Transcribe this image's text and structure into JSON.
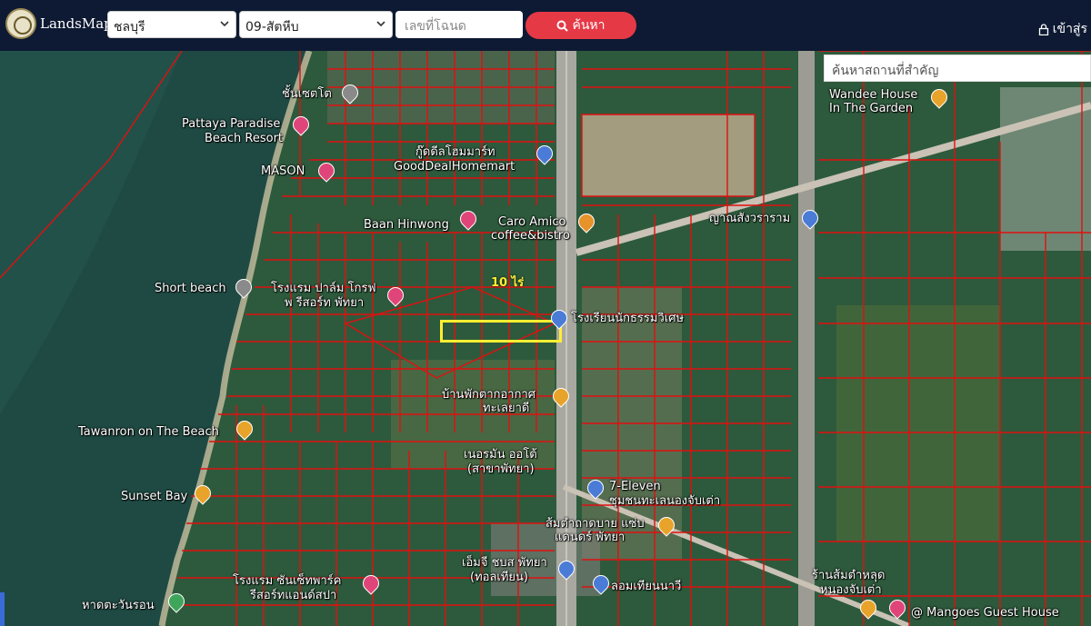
{
  "header": {
    "brand": "LandsMaps",
    "province": "ชลบุรี",
    "district": "09-สัตหีบ",
    "deed_placeholder": "เลขที่โฉนด",
    "search_label": "ค้นหา",
    "login_label": "เข้าสู่ร"
  },
  "map": {
    "place_search_placeholder": "ค้นหาสถานที่สำคัญ",
    "highlight_label": "10 ไร่",
    "places": [
      {
        "name": "ชั้นเซตโต",
        "icon": "photo-pin-icon"
      },
      {
        "name": "Pattaya Paradise",
        "icon": "hotel-pin-icon"
      },
      {
        "name": "Beach Resort",
        "icon": ""
      },
      {
        "name": "MASON",
        "icon": "hotel-pin-icon"
      },
      {
        "name": "กู๊ดดีลโฮมมาร์ท",
        "icon": "shop-pin-icon"
      },
      {
        "name": "GoodDealHomemart",
        "icon": ""
      },
      {
        "name": "Baan Hinwong",
        "icon": "hotel-pin-icon"
      },
      {
        "name": "Caro Amico",
        "icon": "cafe-pin-icon"
      },
      {
        "name": "coffee&bistro",
        "icon": ""
      },
      {
        "name": "ญาณสังวราราม",
        "icon": "temple-pin-icon"
      },
      {
        "name": "Wandee House",
        "icon": "restaurant-pin-icon"
      },
      {
        "name": "In The Garden",
        "icon": ""
      },
      {
        "name": "Short beach",
        "icon": "photo-pin-icon"
      },
      {
        "name": "โรงแรม ปาล์ม โกรฟ",
        "icon": "hotel-pin-icon"
      },
      {
        "name": "พ รีสอร์ท พัทยา",
        "icon": ""
      },
      {
        "name": "โรงเรียนนักธรรมวิเศษ",
        "icon": "school-pin-icon"
      },
      {
        "name": "บ้านพักตากอากาศ",
        "icon": "restaurant-pin-icon"
      },
      {
        "name": "ทะเลยาดี",
        "icon": ""
      },
      {
        "name": "Tawanron on The Beach",
        "icon": "restaurant-pin-icon"
      },
      {
        "name": "เนอรมัน ออโต้",
        "icon": ""
      },
      {
        "name": "(สาขาพัทยา)",
        "icon": ""
      },
      {
        "name": "7-Eleven",
        "icon": "shop-pin-icon"
      },
      {
        "name": "ชุมชนทะเลนองจับเต่า",
        "icon": ""
      },
      {
        "name": "Sunset Bay",
        "icon": "restaurant-pin-icon"
      },
      {
        "name": "ส้มตำถาดบาย แซ่บ",
        "icon": "restaurant-pin-icon"
      },
      {
        "name": "แดนดร์ พัทยา",
        "icon": ""
      },
      {
        "name": "เอ็มจี ชบส พัทยา",
        "icon": "shop-pin-icon"
      },
      {
        "name": "(ทอลเทียน)",
        "icon": ""
      },
      {
        "name": "โรงแรม ซันเซ็ทพาร์ค",
        "icon": "hotel-pin-icon"
      },
      {
        "name": "รีสอร์ทแอนด์สปา",
        "icon": ""
      },
      {
        "name": "ลอมเทียนนาวี",
        "icon": "shop-pin-icon"
      },
      {
        "name": "ร้านส้มตำหลุด",
        "icon": ""
      },
      {
        "name": "หนองจับเต่า",
        "icon": "restaurant-pin-icon"
      },
      {
        "name": "หาดตะวันรอน",
        "icon": "park-pin-icon"
      },
      {
        "name": "@ Mangoes Guest House",
        "icon": "hotel-pin-icon"
      }
    ]
  },
  "colors": {
    "topbar": "#0e1a33",
    "search_button": "#e63946",
    "parcel_lines": "#e01010",
    "highlight": "#ffee33",
    "sea": "#1f4a43"
  }
}
